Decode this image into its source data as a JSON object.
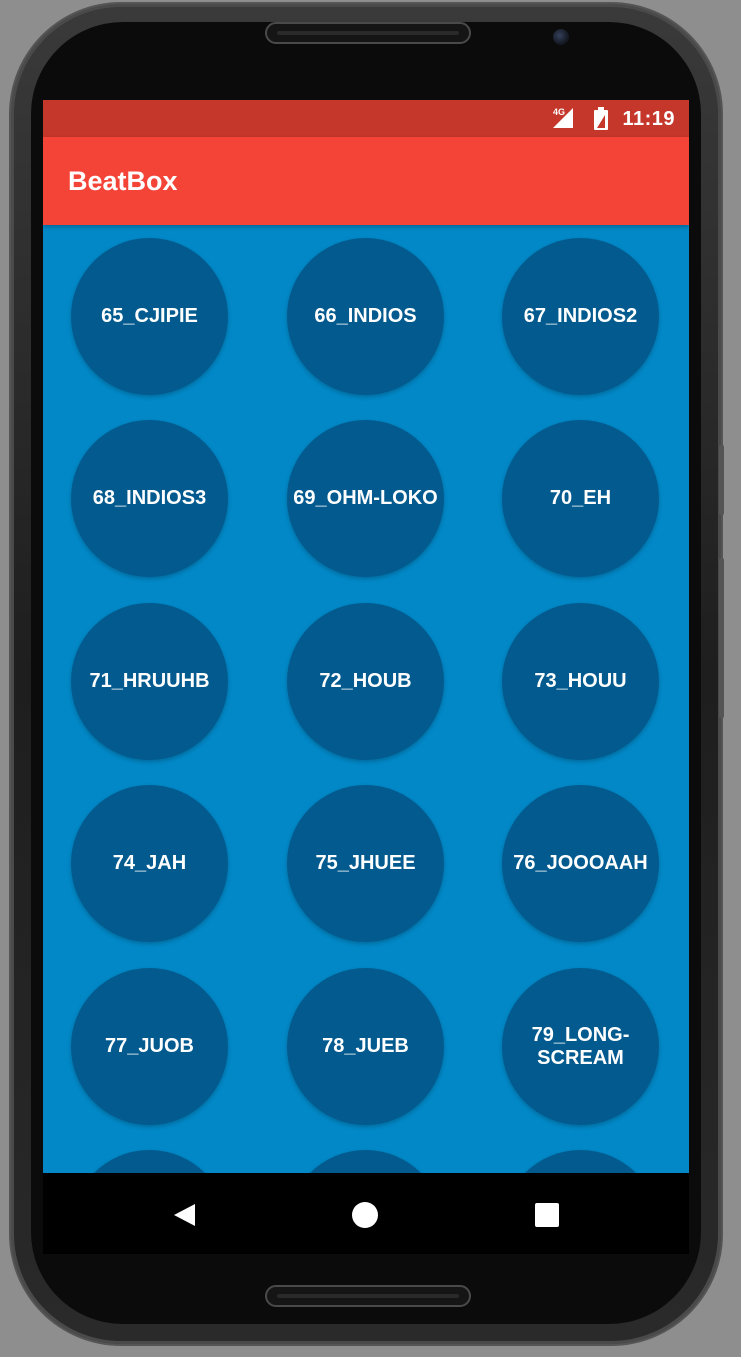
{
  "status_bar": {
    "time": "11:19",
    "network": "4G"
  },
  "app_bar": {
    "title": "BeatBox"
  },
  "sounds": [
    {
      "label": "65_CJIPIE"
    },
    {
      "label": "66_INDIOS"
    },
    {
      "label": "67_INDIOS2"
    },
    {
      "label": "68_INDIOS3"
    },
    {
      "label": "69_OHM-LOKO"
    },
    {
      "label": "70_EH"
    },
    {
      "label": "71_HRUUHB"
    },
    {
      "label": "72_HOUB"
    },
    {
      "label": "73_HOUU"
    },
    {
      "label": "74_JAH"
    },
    {
      "label": "75_JHUEE"
    },
    {
      "label": "76_JOOOAAH"
    },
    {
      "label": "77_JUOB"
    },
    {
      "label": "78_JUEB"
    },
    {
      "label": "79_LONG-SCREAM"
    }
  ],
  "nav": {
    "back": "back-icon",
    "home": "home-icon",
    "recents": "recents-icon"
  },
  "colors": {
    "status_bar": "#c5362b",
    "app_bar": "#f44437",
    "background": "#0288c7",
    "button": "#025a8e"
  }
}
